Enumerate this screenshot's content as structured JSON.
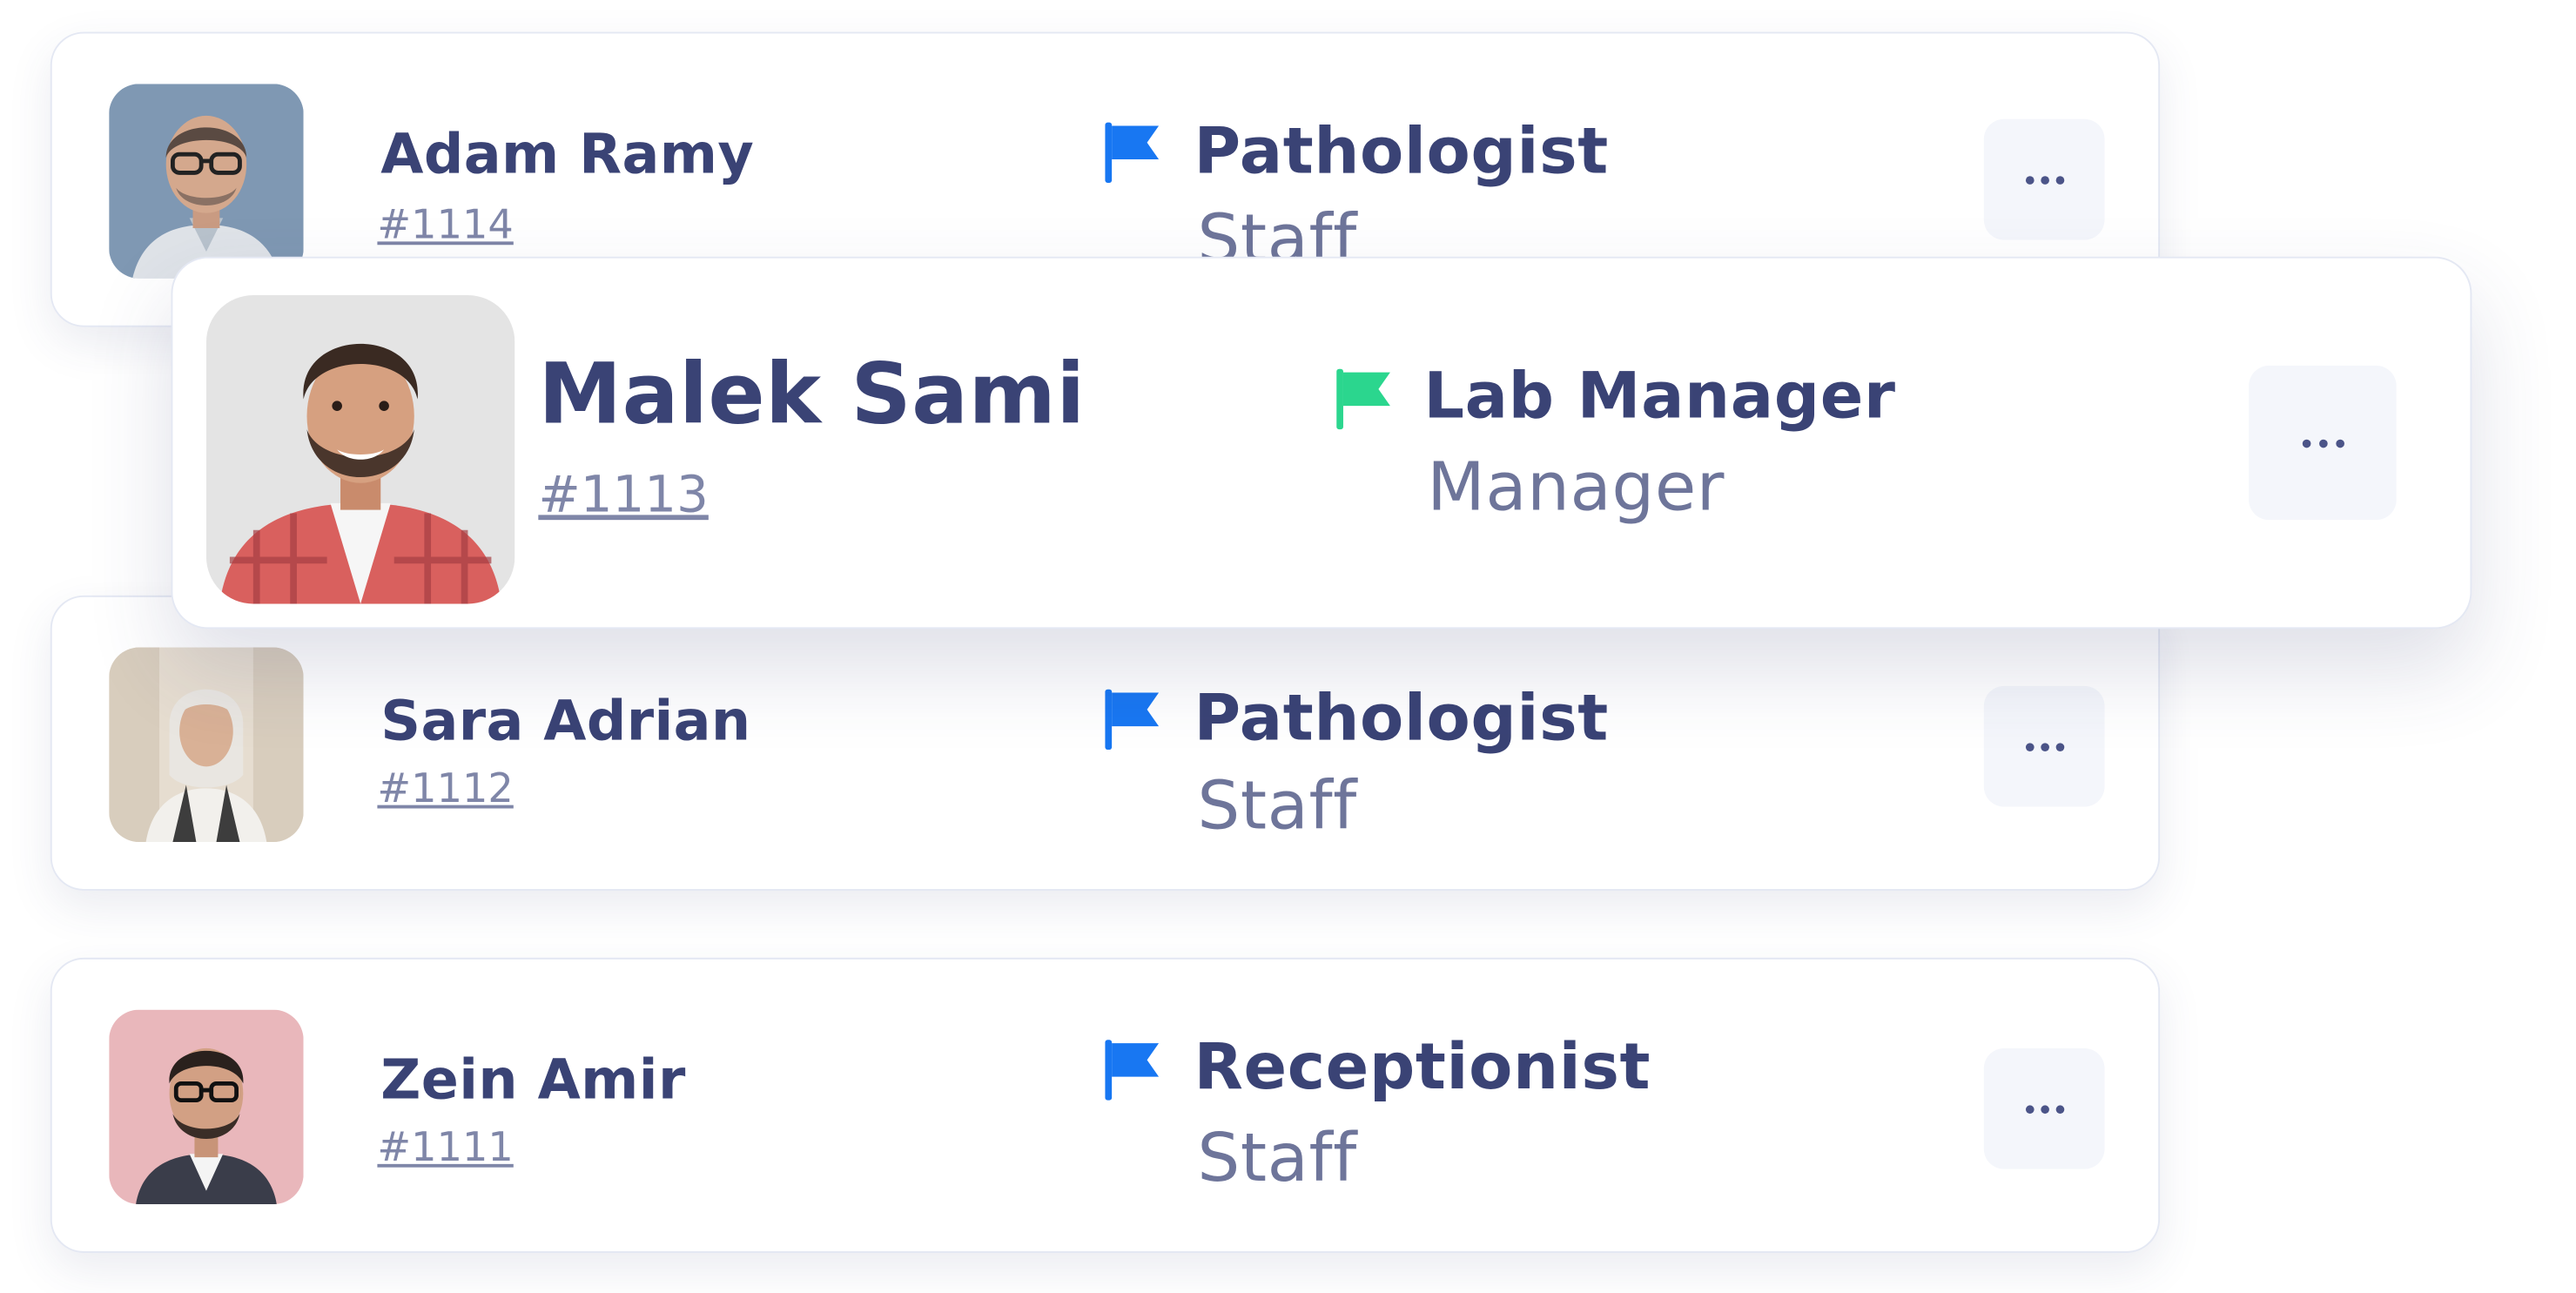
{
  "staff": [
    {
      "name": "Adam Ramy",
      "id": "#1114",
      "role": "Pathologist",
      "level": "Staff",
      "flag_color": "#1877f2",
      "avatar_icon": "avatar-photo-adam-ramy"
    },
    {
      "name": "Malek Sami",
      "id": "#1113",
      "role": "Lab Manager",
      "level": "Manager",
      "flag_color": "#2bd68e",
      "avatar_icon": "avatar-photo-malek-sami"
    },
    {
      "name": "Sara Adrian",
      "id": "#1112",
      "role": "Pathologist",
      "level": "Staff",
      "flag_color": "#1877f2",
      "avatar_icon": "avatar-photo-sara-adrian"
    },
    {
      "name": "Zein Amir",
      "id": "#1111",
      "role": "Receptionist",
      "level": "Staff",
      "flag_color": "#1877f2",
      "avatar_icon": "avatar-photo-zein-amir"
    }
  ],
  "icons": {
    "flag": "flag-icon",
    "more": "more-horizontal-icon"
  },
  "colors": {
    "text_primary": "#3a4375",
    "text_secondary": "#6e759a",
    "card_border": "#e4e8f3",
    "button_bg": "#f4f6fb"
  }
}
